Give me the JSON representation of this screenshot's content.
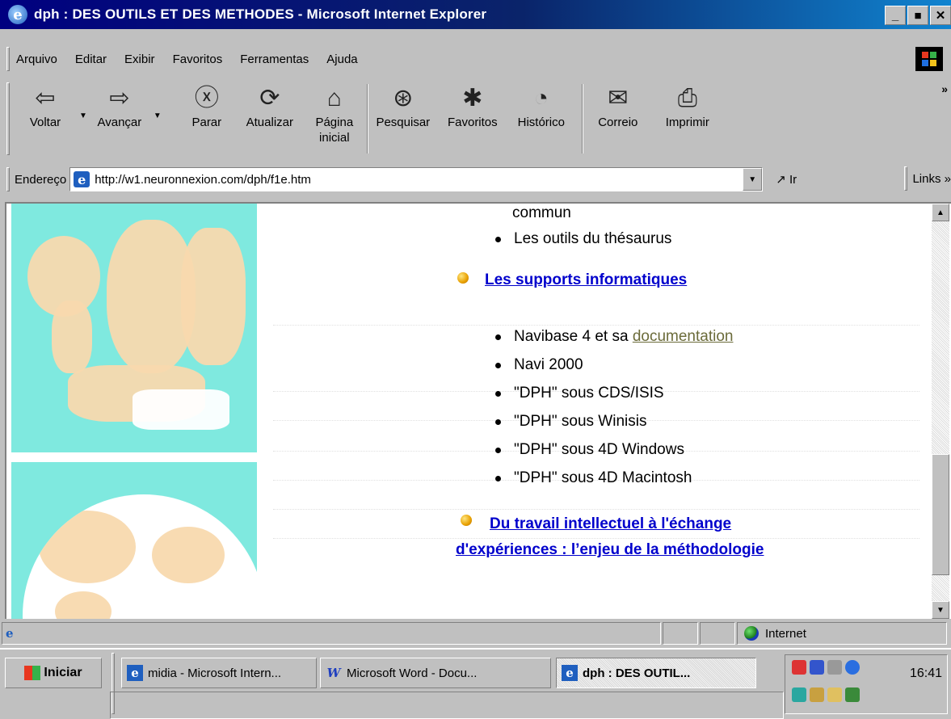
{
  "window": {
    "title": "dph : DES OUTILS ET DES METHODES - Microsoft Internet Explorer",
    "minimize": "_",
    "maximize": "■",
    "close": "✕"
  },
  "menu": [
    "Arquivo",
    "Editar",
    "Exibir",
    "Favoritos",
    "Ferramentas",
    "Ajuda"
  ],
  "toolbar": {
    "buttons": [
      {
        "label": "Voltar",
        "icon": "back-arrow-icon"
      },
      {
        "label": "Avançar",
        "icon": "forward-arrow-icon"
      },
      {
        "label": "Parar",
        "icon": "stop-icon"
      },
      {
        "label": "Atualizar",
        "icon": "refresh-icon"
      },
      {
        "label": "Página inicial",
        "icon": "home-icon"
      },
      {
        "label": "Pesquisar",
        "icon": "search-icon"
      },
      {
        "label": "Favoritos",
        "icon": "favorites-icon"
      },
      {
        "label": "Histórico",
        "icon": "history-icon"
      },
      {
        "label": "Correio",
        "icon": "mail-icon"
      },
      {
        "label": "Imprimir",
        "icon": "print-icon"
      }
    ],
    "overflow": "»"
  },
  "address": {
    "label": "Endereço",
    "url": "http://w1.neuronnexion.com/dph/f1e.htm",
    "go": "Ir",
    "links": "Links »"
  },
  "content": {
    "top_fragment": "commun",
    "list1": [
      "Les outils du thésaurus"
    ],
    "heading1": "Les supports informatiques",
    "list2_first_prefix": "Navibase 4 et sa ",
    "list2_first_link": "documentation",
    "list2": [
      "Navi 2000",
      "\"DPH\" sous CDS/ISIS",
      "\"DPH\" sous Winisis",
      "\"DPH\" sous 4D Windows",
      "\"DPH\" sous 4D Macintosh"
    ],
    "heading2_line1": "Du travail intellectuel à l'échange",
    "heading2_line2": "d'expériences : l’enjeu de la méthodologie"
  },
  "status": {
    "zone": "Internet"
  },
  "taskbar": {
    "start": "Iniciar",
    "tasks": [
      {
        "label": "midia - Microsoft Intern...",
        "active": false
      },
      {
        "label": "Microsoft Word - Docu...",
        "active": false
      },
      {
        "label": "dph : DES OUTIL...",
        "active": true
      }
    ],
    "clock": "16:41"
  },
  "colors": {
    "titlebar": "#000080",
    "link": "#0000cc",
    "side_bg": "#7fe9df",
    "side_figures": "#f8d9ae"
  }
}
